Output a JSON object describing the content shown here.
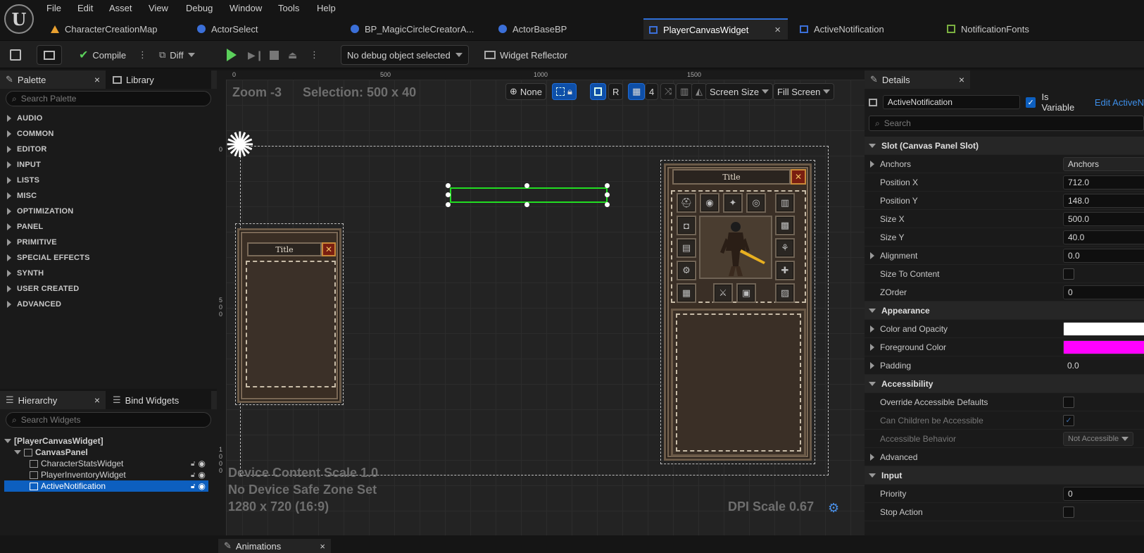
{
  "menu": [
    "File",
    "Edit",
    "Asset",
    "View",
    "Debug",
    "Window",
    "Tools",
    "Help"
  ],
  "tabs": [
    {
      "label": "CharacterCreationMap",
      "icon": "level-icon",
      "color": "#e8a030"
    },
    {
      "label": "ActorSelect",
      "icon": "blueprint-icon",
      "color": "#3b6fd8"
    },
    {
      "label": "BP_MagicCircleCreatorA...",
      "icon": "blueprint-icon",
      "color": "#3b6fd8"
    },
    {
      "label": "ActorBaseBP",
      "icon": "character-blueprint-icon",
      "color": "#3b6fd8"
    },
    {
      "label": "PlayerCanvasWidget",
      "icon": "widget-blueprint-icon",
      "color": "#3b6fd8",
      "active": true,
      "close": "×"
    },
    {
      "label": "ActiveNotification",
      "icon": "widget-blueprint-icon",
      "color": "#3b6fd8"
    },
    {
      "label": "NotificationFonts",
      "icon": "data-table-icon",
      "color": "#7ab040"
    }
  ],
  "toolbar": {
    "compile_label": "Compile",
    "diff_label": "Diff",
    "debug_object": "No debug object selected",
    "widget_reflector": "Widget Reflector"
  },
  "palette": {
    "tab_label": "Palette",
    "close": "×",
    "library_label": "Library",
    "search_placeholder": "Search Palette",
    "categories": [
      "AUDIO",
      "COMMON",
      "EDITOR",
      "INPUT",
      "LISTS",
      "MISC",
      "OPTIMIZATION",
      "PANEL",
      "PRIMITIVE",
      "SPECIAL EFFECTS",
      "SYNTH",
      "USER CREATED",
      "ADVANCED"
    ]
  },
  "hierarchy": {
    "tab_label": "Hierarchy",
    "close": "×",
    "bind_widgets_label": "Bind Widgets",
    "search_placeholder": "Search Widgets",
    "root": "[PlayerCanvasWidget]",
    "canvas": "CanvasPanel",
    "children": [
      "CharacterStatsWidget",
      "PlayerInventoryWidget",
      "ActiveNotification"
    ],
    "selected": "ActiveNotification"
  },
  "viewport": {
    "zoom": "Zoom -3",
    "selection": "Selection: 500 x 40",
    "none_label": "None",
    "r_label": "R",
    "grid_count": "4",
    "screen_size": "Screen Size",
    "fill_screen": "Fill Screen",
    "ruler_h": [
      "0",
      "500",
      "1000",
      "1500"
    ],
    "ruler_v_0": "0",
    "ruler_v_500": [
      "5",
      "0",
      "0"
    ],
    "ruler_v_1000": [
      "1",
      "0",
      "0",
      "0"
    ],
    "device_scale": "Device Content Scale 1.0",
    "safe_zone": "No Device Safe Zone Set",
    "resolution": "1280 x 720 (16:9)",
    "dpi": "DPI Scale 0.67",
    "widget_title": "Title",
    "close_glyph": "✕",
    "inventory_slot_icons": [
      "⛑",
      "◉",
      "✦",
      "◎",
      "▥",
      "◘",
      "▤",
      "⚙",
      "▦",
      "▩",
      "⚘",
      "✚",
      "▨",
      "⚔",
      "▣",
      "⛨"
    ]
  },
  "animations": {
    "tab_label": "Animations",
    "close": "×"
  },
  "details": {
    "tab_label": "Details",
    "close": "×",
    "name": "ActiveNotification",
    "is_variable_label": "Is Variable",
    "edit_link": "Edit ActiveN",
    "search_placeholder": "Search",
    "sections": {
      "slot": "Slot (Canvas Panel Slot)",
      "appearance": "Appearance",
      "accessibility": "Accessibility",
      "input": "Input"
    },
    "rows": {
      "anchors": {
        "label": "Anchors",
        "value": "Anchors"
      },
      "position_x": {
        "label": "Position X",
        "value": "712.0"
      },
      "position_y": {
        "label": "Position Y",
        "value": "148.0"
      },
      "size_x": {
        "label": "Size X",
        "value": "500.0"
      },
      "size_y": {
        "label": "Size Y",
        "value": "40.0"
      },
      "alignment": {
        "label": "Alignment",
        "value": "0.0"
      },
      "size_to_content": {
        "label": "Size To Content"
      },
      "zorder": {
        "label": "ZOrder",
        "value": "0"
      },
      "color_opacity": {
        "label": "Color and Opacity",
        "color": "#ffffff"
      },
      "foreground": {
        "label": "Foreground Color",
        "color": "#ff00ff"
      },
      "padding": {
        "label": "Padding",
        "value": "0.0"
      },
      "override_accessible": {
        "label": "Override Accessible Defaults"
      },
      "can_children": {
        "label": "Can Children be Accessible",
        "check": "✓"
      },
      "accessible_behavior": {
        "label": "Accessible Behavior",
        "value": "Not Accessible"
      },
      "advanced": {
        "label": "Advanced"
      },
      "priority": {
        "label": "Priority",
        "value": "0"
      },
      "stop_action": {
        "label": "Stop Action"
      }
    }
  },
  "colors": {
    "accent": "#2f6fd8",
    "selection_green": "#22dd22",
    "selected_row": "#0d5fbf"
  }
}
